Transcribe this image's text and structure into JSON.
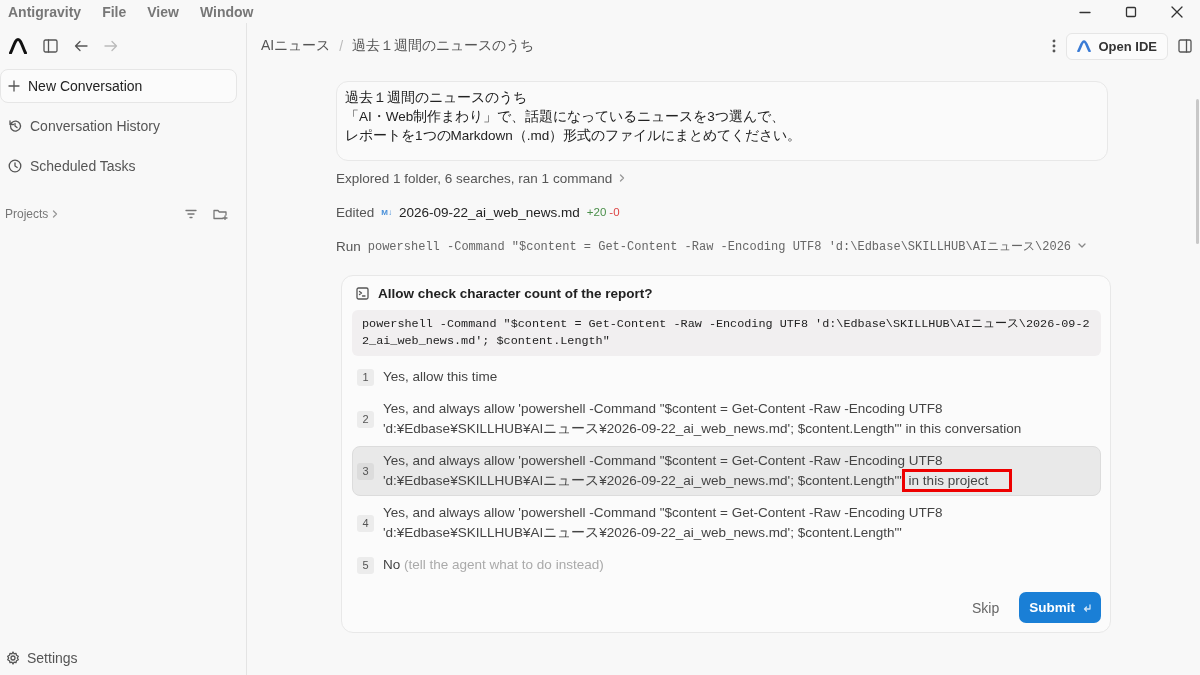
{
  "menu_bar": {
    "app_name": "Antigravity",
    "items": [
      "File",
      "View",
      "Window"
    ]
  },
  "toolbar": {
    "forward_disabled": true
  },
  "sidebar": {
    "items": [
      {
        "kind": "new",
        "label": "New Conversation",
        "selected": false
      },
      {
        "kind": "history",
        "label": "Conversation History",
        "selected": false
      },
      {
        "kind": "scheduled",
        "label": "Scheduled Tasks",
        "selected": false
      }
    ],
    "projects_label": "Projects",
    "settings_label": "Settings"
  },
  "breadcrumb": [
    "AIニュース",
    "過去１週間のニュースのうち"
  ],
  "breadcrumb_separator": "/",
  "open_ide_label": "Open IDE",
  "message": {
    "lines": [
      "過去１週間のニュースのうち",
      "「AI・Web制作まわり」で、話題になっているニュースを3つ選んで、",
      "レポートを1つのMarkdown（.md）形式のファイルにまとめてください。"
    ]
  },
  "steps": [
    {
      "kind": "summary",
      "text": "Explored 1 folder, 6 searches, ran 1 command"
    },
    {
      "kind": "edit",
      "verb": "Edited",
      "badge": "M↓",
      "file": "2026-09-22_ai_web_news.md",
      "added": "+20",
      "removed": "-0"
    },
    {
      "kind": "run",
      "verb": "Run",
      "command": "powershell -Command \"$content = Get-Content -Raw -Encoding UTF8 'd:\\Edbase\\SKILLHUB\\AIニュース\\2026"
    }
  ],
  "dialog": {
    "title": "Allow check character count of the report?",
    "command": "powershell -Command \"$content = Get-Content -Raw -Encoding UTF8 'd:\\Edbase\\SKILLHUB\\AIニュース\\2026-09-22_ai_web_news.md'; $content.Length\"",
    "options": [
      {
        "number": "1",
        "text": "Yes, allow this time",
        "selected": false
      },
      {
        "number": "2",
        "text": "Yes, and always allow 'powershell -Command \"$content = Get-Content -Raw -Encoding UTF8\n'd:¥Edbase¥SKILLHUB¥AIニュース¥2026-09-22_ai_web_news.md'; $content.Length\"'",
        "scope": "in this conversation",
        "selected": false
      },
      {
        "number": "3",
        "text": "Yes, and always allow 'powershell -Command \"$content = Get-Content -Raw -Encoding UTF8\n'd:¥Edbase¥SKILLHUB¥AIニュース¥2026-09-22_ai_web_news.md'; $content.Length\"'",
        "scope": "in this project",
        "scope_highlighted": true,
        "selected": true
      },
      {
        "number": "4",
        "text": "Yes, and always allow 'powershell -Command \"$content = Get-Content -Raw -Encoding UTF8\n'd:¥Edbase¥SKILLHUB¥AIニュース¥2026-09-22_ai_web_news.md'; $content.Length\"'",
        "selected": false
      },
      {
        "number": "5",
        "text": "No",
        "hint": "(tell the agent what to do instead)",
        "selected": false
      }
    ],
    "skip_label": "Skip",
    "submit_label": "Submit"
  }
}
